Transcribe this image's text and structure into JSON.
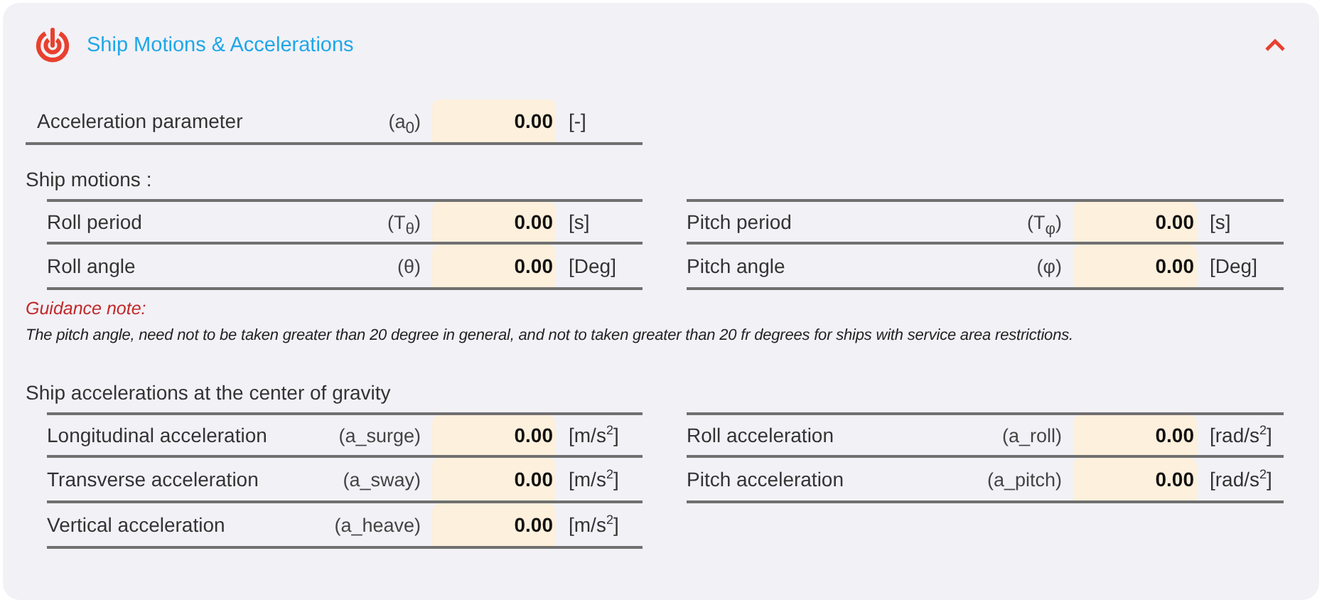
{
  "panel": {
    "title": "Ship Motions & Accelerations",
    "expanded": true
  },
  "acceleration_parameter": {
    "label": "Acceleration parameter",
    "symbol": "(a$_{0}$)",
    "value": "0.00",
    "unit": "[-]"
  },
  "ship_motions": {
    "heading": "Ship motions :",
    "left": [
      {
        "label": "Roll period",
        "symbol": "(T$_{θ}$)",
        "value": "0.00",
        "unit": "[s]"
      },
      {
        "label": "Roll angle",
        "symbol": "(θ)",
        "value": "0.00",
        "unit": "[Deg]"
      }
    ],
    "right": [
      {
        "label": "Pitch period",
        "symbol": "(T$_{φ}$)",
        "value": "0.00",
        "unit": "[s]"
      },
      {
        "label": "Pitch angle",
        "symbol": "(φ)",
        "value": "0.00",
        "unit": "[Deg]"
      }
    ]
  },
  "guidance_note": {
    "title": "Guidance note:",
    "text": "The pitch angle, need not to be taken greater than 20 degree in general, and not to taken greater than 20 fr degrees for ships with service area restrictions."
  },
  "ship_accelerations": {
    "heading": "Ship accelerations at the center of gravity",
    "left": [
      {
        "label": "Longitudinal acceleration",
        "symbol": "(a_surge)",
        "value": "0.00",
        "unit": "[m/s$^{2}$]"
      },
      {
        "label": "Transverse acceleration",
        "symbol": "(a_sway)",
        "value": "0.00",
        "unit": "[m/s$^{2}$]"
      },
      {
        "label": "Vertical acceleration",
        "symbol": "(a_heave)",
        "value": "0.00",
        "unit": "[m/s$^{2}$]"
      }
    ],
    "right": [
      {
        "label": "Roll acceleration",
        "symbol": "(a_roll)",
        "value": "0.00",
        "unit": "[rad/s$^{2}$]"
      },
      {
        "label": "Pitch acceleration",
        "symbol": "(a_pitch)",
        "value": "0.00",
        "unit": "[rad/s$^{2}$]"
      }
    ]
  }
}
